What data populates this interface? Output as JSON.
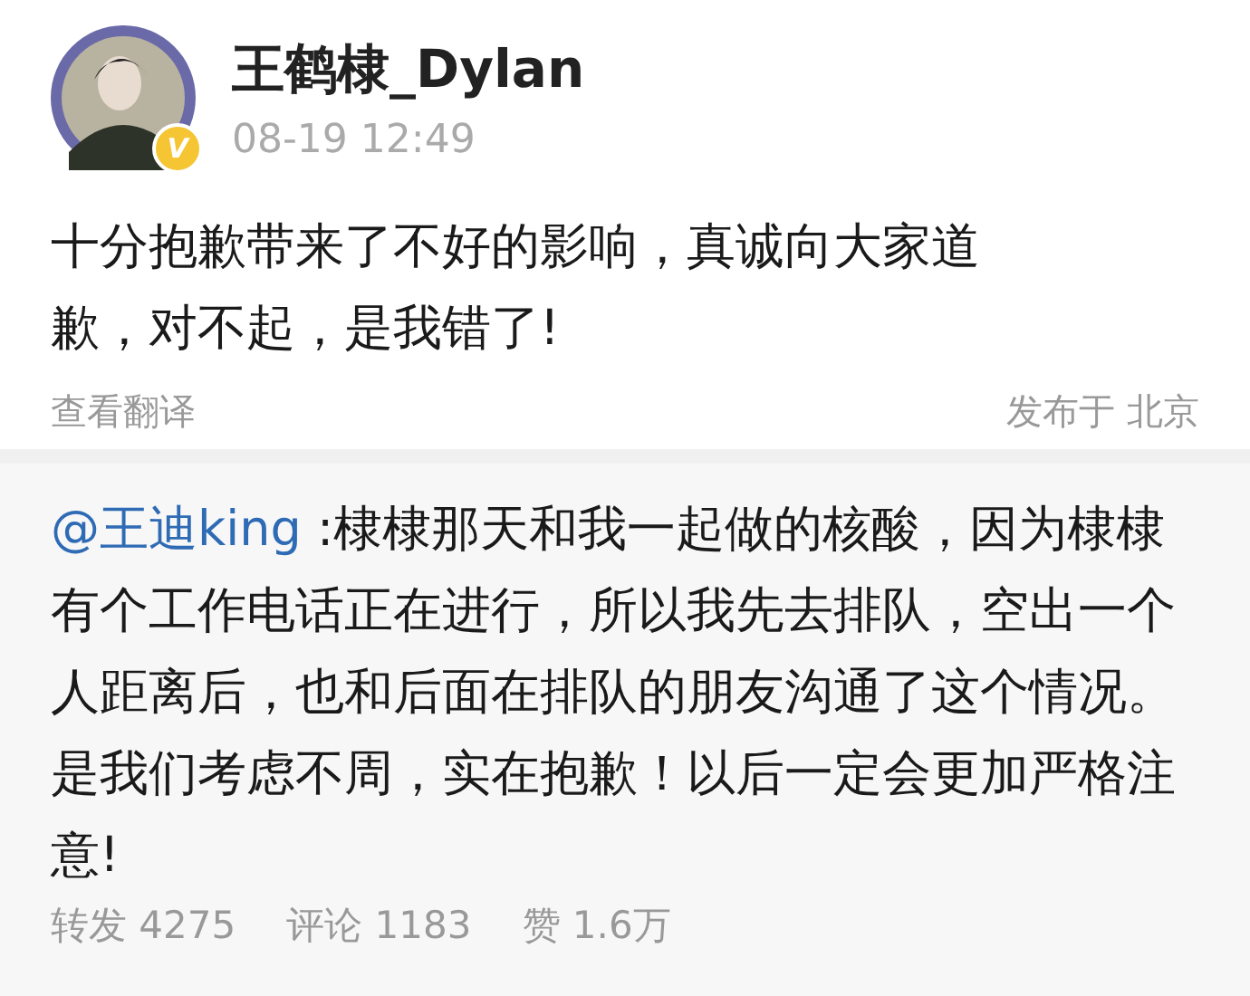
{
  "post": {
    "author": "王鹤棣_Dylan",
    "verified_badge": "V",
    "time": "08-19 12:49",
    "text": "十分抱歉带来了不好的影响，真诚向大家道歉，对不起，是我错了!",
    "translate_link": "查看翻译",
    "location": "发布于 北京"
  },
  "repost": {
    "mention": "@王迪king",
    "text": " :棣棣那天和我一起做的核酸，因为棣棣有个工作电话正在进行，所以我先去排队，空出一个人距离后，也和后面在排队的朋友沟通了这个情况。是我们考虑不周，实在抱歉！以后一定会更加严格注意!",
    "stats": [
      {
        "label": "转发",
        "count": "4275"
      },
      {
        "label": "评论",
        "count": "1183"
      },
      {
        "label": "赞",
        "count": "1.6万"
      }
    ]
  }
}
